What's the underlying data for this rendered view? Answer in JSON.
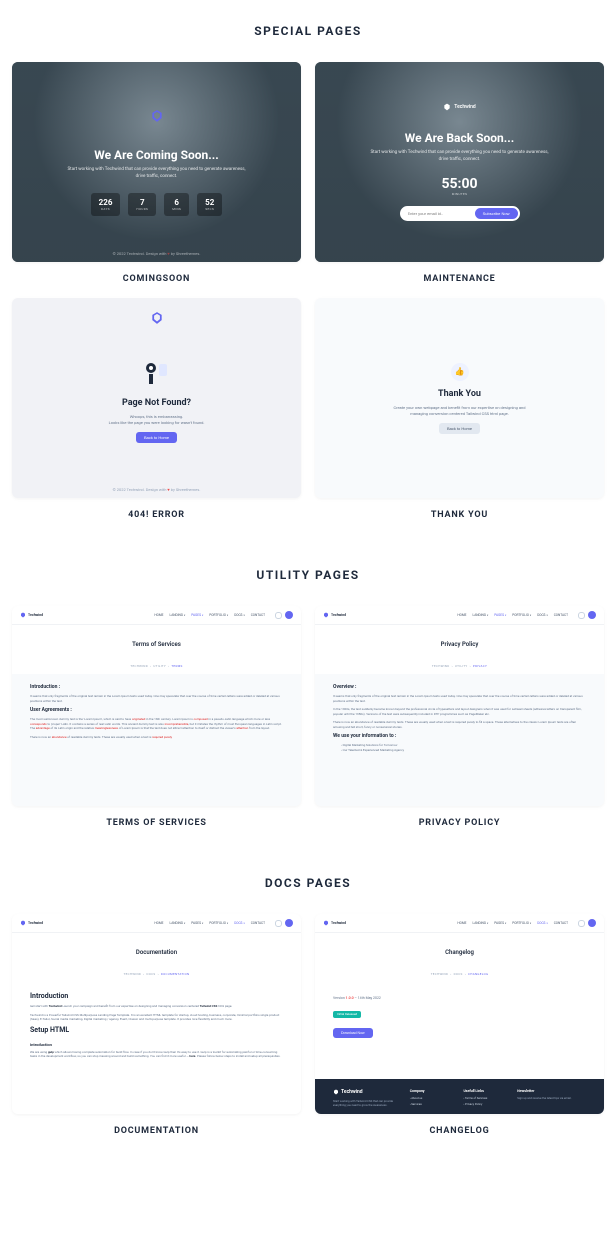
{
  "sections": {
    "special": "SPECIAL PAGES",
    "utility": "UTILITY PAGES",
    "docs": "DOCS PAGES"
  },
  "labels": {
    "comingsoon": "COMINGSOON",
    "maintenance": "MAINTENANCE",
    "error404": "404! ERROR",
    "thankyou": "THANK YOU",
    "terms": "TERMS OF SERVICES",
    "privacy": "PRIVACY POLICY",
    "documentation": "DOCUMENTATION",
    "changelog": "CHANGELOG"
  },
  "comingsoon": {
    "title": "We Are Coming Soon...",
    "sub": "Start working with Techwind that can provide everything you need to generate awareness, drive traffic, connect.",
    "cd": [
      {
        "v": "226",
        "l": "DAYS"
      },
      {
        "v": "7",
        "l": "HOURS"
      },
      {
        "v": "6",
        "l": "MINS"
      },
      {
        "v": "52",
        "l": "SECS"
      }
    ],
    "footer_a": "© 2022 Techwind. Design with ",
    "footer_b": " by Shreethemes."
  },
  "maintenance": {
    "brand": "Techwind",
    "title": "We Are Back Soon...",
    "sub": "Start working with Techwind that can provide everything you need to generate awareness, drive traffic, connect.",
    "timer": "55:00",
    "timer_lbl": "MINUTES",
    "placeholder": "Enter your email id..",
    "subscribe": "Subscribe Now"
  },
  "error404": {
    "title": "Page Not Found?",
    "sub1": "Whoops, this is embarrassing.",
    "sub2": "Looks like the page you were looking for wasn't found.",
    "btn": "Back to Home",
    "footer_a": "© 2022 Techwind. Design with ",
    "footer_b": " by Shreethemes."
  },
  "thankyou": {
    "title": "Thank You",
    "sub": "Create your own webpage and benefit from our expertise on designing and managing conversion centered Tailwind CSS html page.",
    "btn": "Back to Home"
  },
  "topbar": {
    "brand": "Techwind",
    "nav": [
      "HOME",
      "LANDING",
      "PAGES",
      "PORTFOLIO",
      "DOCS",
      "CONTACT"
    ]
  },
  "terms": {
    "title": "Terms of Services",
    "crumb_a": "TECHWIND",
    "crumb_b": "UTILITY",
    "crumb_c": "TERMS",
    "h1": "Introduction :",
    "p1": "It seems that only fragments of the original text remain in the Lorem Ipsum texts used today. One may speculate that over the course of time certain letters were added or deleted at various positions within the text.",
    "h2": "User Agreements :",
    "p2a": "The most well-known dummy text is the 'Lorem Ipsum', which is said to have ",
    "p2b": "originated",
    "p2c": " in the 16th century. Lorem Ipsum is ",
    "p2d": "composed",
    "p2e": " in a pseudo-Latin language which more or less ",
    "p2f": "corresponds",
    "p2g": " to 'proper' Latin. It contains a series of real Latin words. This ancient dummy text is also ",
    "p2h": "incomprehensible",
    "p2i": ", but it imitates the rhythm of most European languages in Latin script. The ",
    "p2j": "advantage",
    "p2k": " of its Latin origin and the relative ",
    "p2l": "meaninglessness",
    "p2m": " of Lorem Ipsum is that the text does not attract attention to itself or distract the viewer's ",
    "p2n": "attention",
    "p2o": " from the layout.",
    "p3a": "There is now an ",
    "p3b": "abundance",
    "p3c": " of readable dummy texts. These are usually used when a text is ",
    "p3d": "required purely"
  },
  "privacy": {
    "title": "Privacy Policy",
    "crumb_a": "TECHWIND",
    "crumb_b": "UTILITY",
    "crumb_c": "PRIVACY",
    "h1": "Overview :",
    "p1": "It seems that only fragments of the original text remain in the Lorem Ipsum texts used today. One may speculate that over the course of time certain letters were added or deleted at various positions within the text.",
    "p2": "In the 1960s, the text suddenly became known beyond the professional circle of typesetters and layout designers when it was used for Letraset sheets (adhesive letters on transparent film, popular until the 1980s). Versions of the text were subsequently included in DTP programmes such as PageMaker etc.",
    "p3": "There is now an abundance of readable dummy texts. These are usually used when a text is required purely to fill a space. These alternatives to the classic Lorem Ipsum texts are often amusing and tell short, funny or nonsensical stories.",
    "h2": "We use your information to :",
    "li1": "Digital Marketing Solutions for Tomorrow",
    "li2": "Our Talented & Experienced Marketing Agency"
  },
  "documentation": {
    "title": "Documentation",
    "crumb_a": "TECHWIND",
    "crumb_b": "DOCS",
    "crumb_c": "DOCUMENTATION",
    "h1": "Introduction",
    "p1a": "Get start with ",
    "p1b": "Techwind",
    "p1c": " Launch your campaign and benefit from our expertise on designing and managing conversion centered ",
    "p1d": "Tailwind CSS",
    "p1e": " html page.",
    "p2": "Techwind is a Powerful Tailwind CSS Multipurpose Landing Page Template. It is an excellent HTML template for startup, cloud hosting, business, corporate, minimal portfolio single product (Saas), E-Tailor, Social media marketing, Digital marketing / agency, Event, Classic and multi-purpose template. It provides nice flexibility and much more.",
    "h2": "Setup HTML",
    "h3": "Introduction",
    "p3a": "We are using ",
    "p3b": "gulp",
    "p3c": " which allows having complete automation for build flow. In case if you don't know Gulp then it's easy to use it. Gulp is a toolkit for automating painful or time-consuming tasks in the development workflow, so you can stop messing around and build something. You can find it more useful — ",
    "p3d": "here",
    "p3e": ". Please follow below steps to install and setup all prerequisites."
  },
  "changelog": {
    "title": "Changelog",
    "crumb_a": "TECHWIND",
    "crumb_b": "DOCS",
    "crumb_c": "CHANGELOG",
    "ver_label": "Version ",
    "ver": "1.0.0",
    "ver_date": " – 14th May 2022",
    "badge": "Initial Released",
    "dl": "Download Now"
  },
  "footer": {
    "brand": "Techwind",
    "p": "Start working with Tailwind CSS that can provide everything you need to grow the awareness.",
    "c1": "Company",
    "c1a": "About us",
    "c1b": "Services",
    "c2": "Usefull Links",
    "c2a": "Terms of Services",
    "c2b": "Privacy Policy",
    "c3": "Newsletter",
    "c3p": "Sign up and receive the latest tips via email."
  }
}
